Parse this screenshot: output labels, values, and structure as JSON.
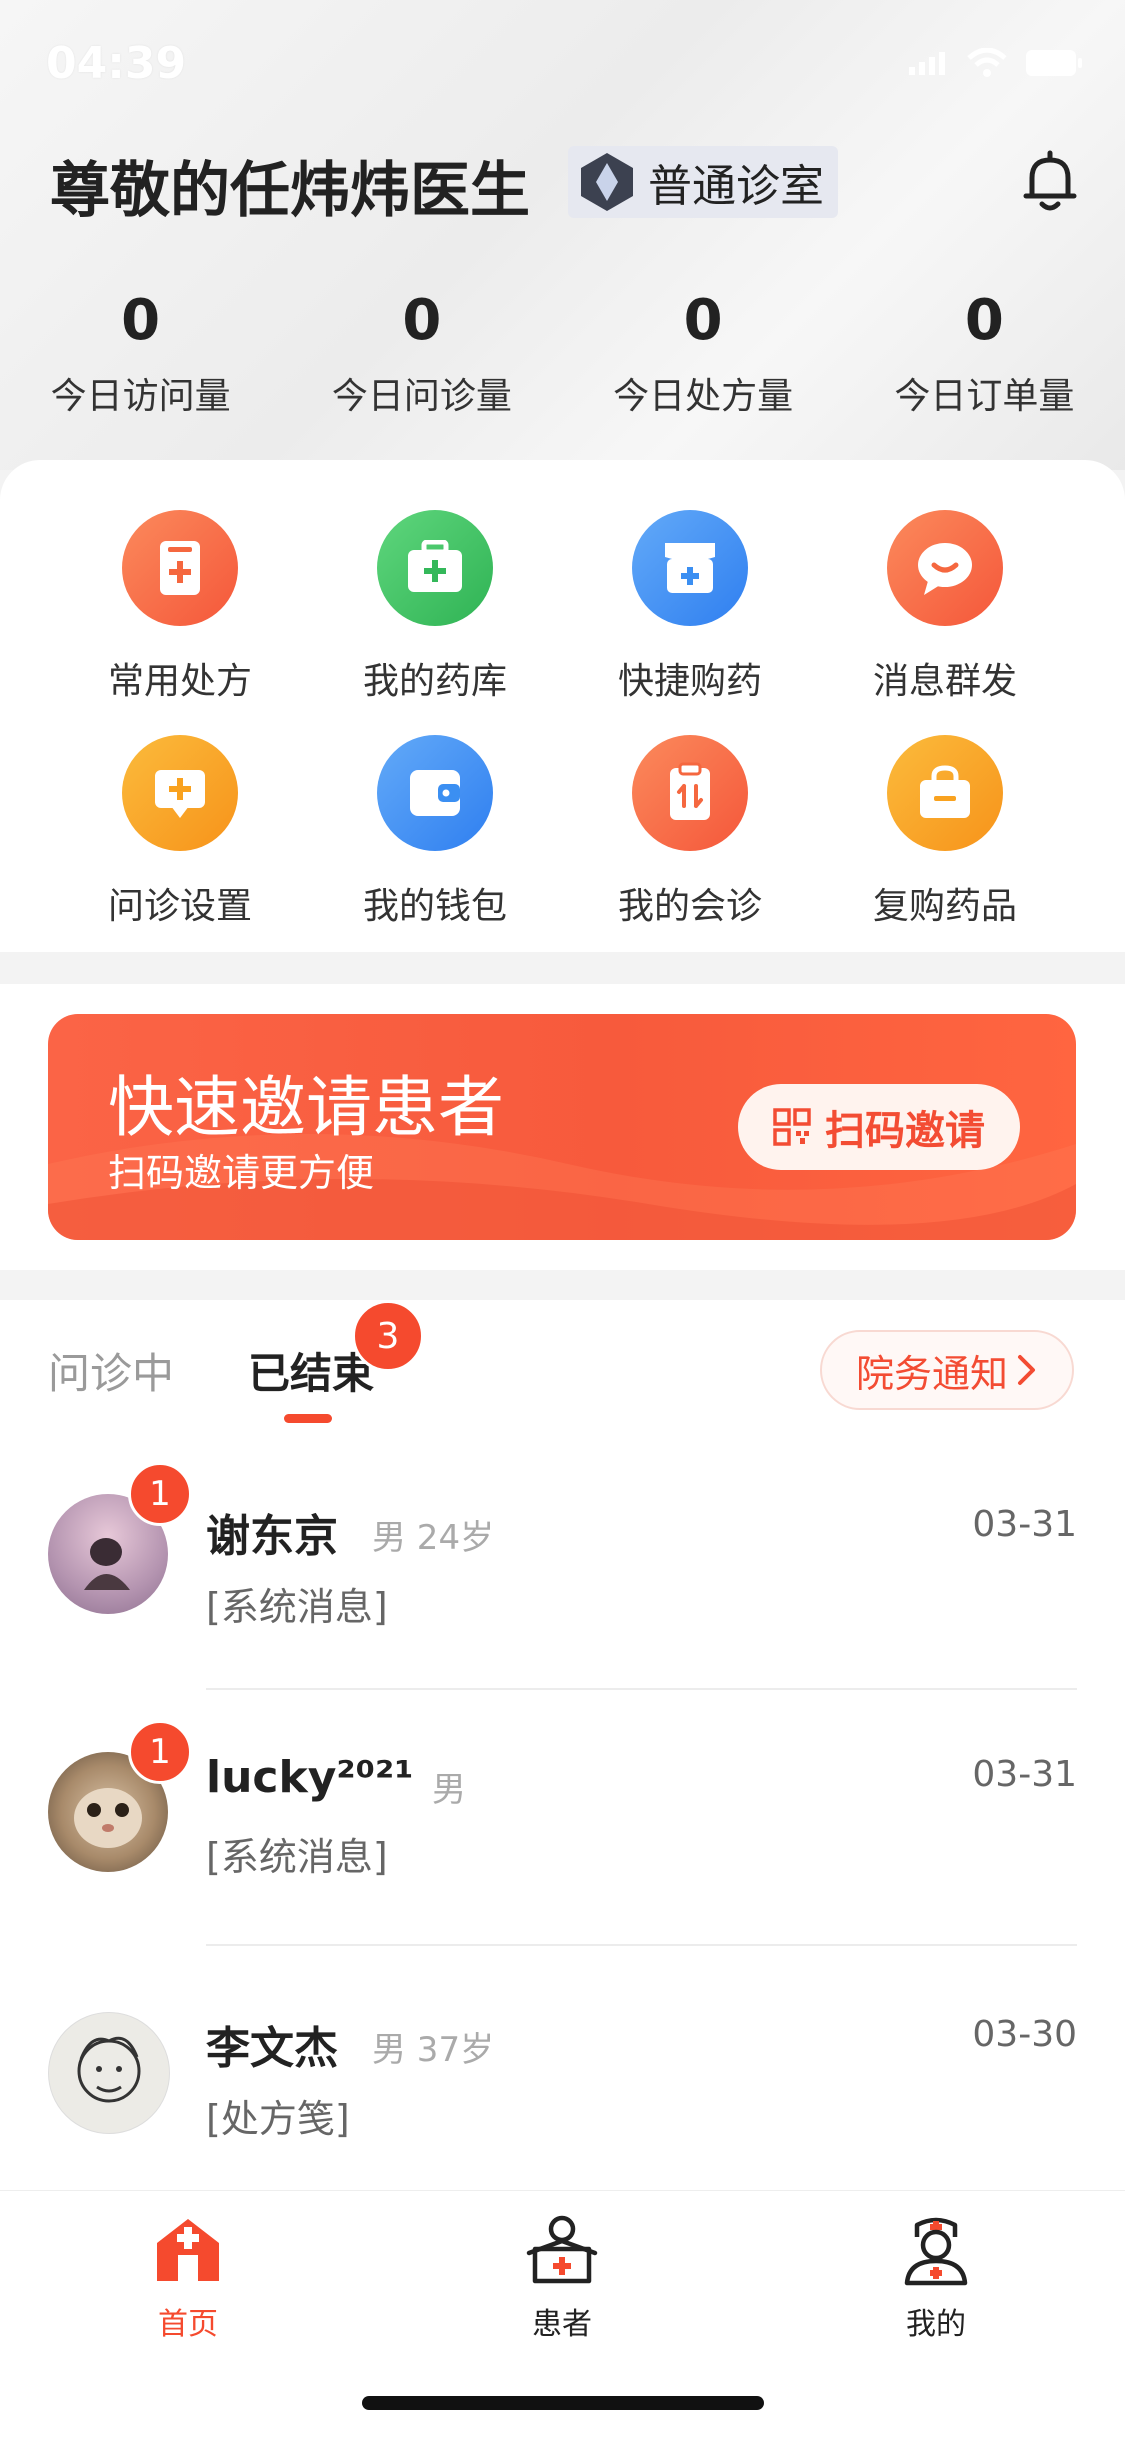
{
  "status_bar": {
    "time": "04:39"
  },
  "header": {
    "doctor_title": "尊敬的任炜炜医生",
    "clinic_badge": "普通诊室",
    "stats": [
      {
        "value": "0",
        "label": "今日访问量"
      },
      {
        "value": "0",
        "label": "今日问诊量"
      },
      {
        "value": "0",
        "label": "今日处方量"
      },
      {
        "value": "0",
        "label": "今日订单量"
      }
    ]
  },
  "quick_actions": [
    {
      "label": "常用处方",
      "icon": "prescription-icon",
      "color": "#f7643f"
    },
    {
      "label": "我的药库",
      "icon": "medicine-kit-icon",
      "color": "#3fc165"
    },
    {
      "label": "快捷购药",
      "icon": "shop-icon",
      "color": "#3b8ff2"
    },
    {
      "label": "消息群发",
      "icon": "chat-bubble-icon",
      "color": "#f7643f"
    },
    {
      "label": "问诊设置",
      "icon": "consult-settings-icon",
      "color": "#f9a21f"
    },
    {
      "label": "我的钱包",
      "icon": "wallet-icon",
      "color": "#3b8ff2"
    },
    {
      "label": "我的会诊",
      "icon": "consultation-icon",
      "color": "#f7643f"
    },
    {
      "label": "复购药品",
      "icon": "shopping-bag-icon",
      "color": "#f9a21f"
    }
  ],
  "banner": {
    "title": "快速邀请患者",
    "subtitle": "扫码邀请更方便",
    "button": "扫码邀请"
  },
  "tabs": {
    "inactive": "问诊中",
    "active": "已结束",
    "badge": "3",
    "notice_button": "院务通知"
  },
  "patients": [
    {
      "name": "谢东京",
      "meta": "男 24岁",
      "message": "[系统消息]",
      "date": "03-31",
      "unread": "1"
    },
    {
      "name": "lucky²⁰²¹",
      "meta": "男",
      "message": "[系统消息]",
      "date": "03-31",
      "unread": "1"
    },
    {
      "name": "李文杰",
      "meta": "男 37岁",
      "message": "[处方笺]",
      "date": "03-30",
      "unread": ""
    }
  ],
  "bottom_nav": [
    {
      "label": "首页",
      "icon": "home-icon",
      "active": true
    },
    {
      "label": "患者",
      "icon": "patient-icon",
      "active": false
    },
    {
      "label": "我的",
      "icon": "doctor-icon",
      "active": false
    }
  ],
  "colors": {
    "accent": "#f54a2e",
    "text": "#222222"
  }
}
